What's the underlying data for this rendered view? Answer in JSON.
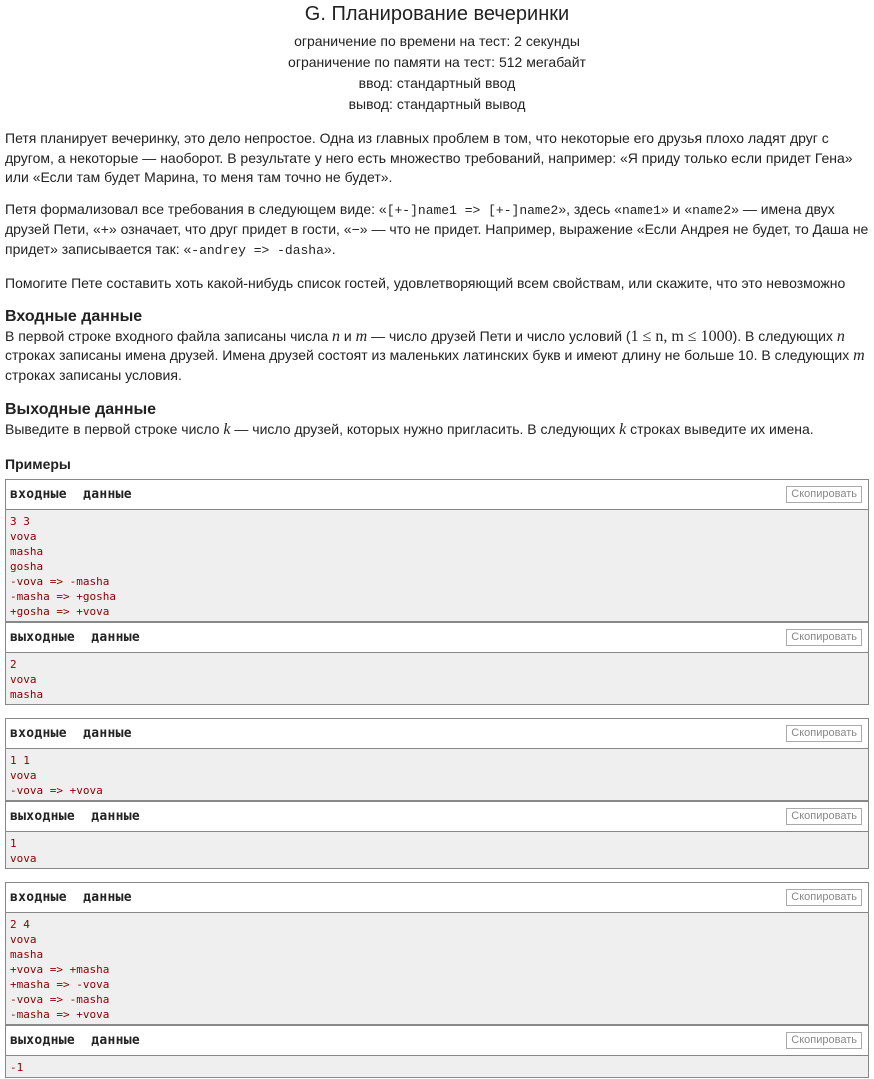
{
  "problem": {
    "title": "G. Планирование вечеринки",
    "time_limit": "ограничение по времени на тест: 2 секунды",
    "memory_limit": "ограничение по памяти на тест: 512 мегабайт",
    "input": "ввод: стандартный ввод",
    "output": "вывод: стандартный вывод"
  },
  "statement": {
    "p1": "Петя планирует вечеринку, это дело непростое. Одна из главных проблем в том, что некоторые его друзья плохо ладят друг с другом, а некоторые — наоборот. В результате у него есть множество требований, например: «Я приду только если придет Гена» или «Если там будет Марина, то меня там точно не будет».",
    "p2_a": "Петя формализовал все требования в следующем виде: «",
    "p2_code1": "[+-]name1 => [+-]name2",
    "p2_b": "», здесь «",
    "p2_code2": "name1",
    "p2_c": "» и «",
    "p2_code3": "name2",
    "p2_d": "» — имена двух друзей Пети, «+» означает, что друг придет в гости, «−» — что не придет. Например, выражение «Если Андрея не будет, то Даша не придет» записывается так: «",
    "p2_code4": "-andrey => -dasha",
    "p2_e": "».",
    "p3": "Помогите Пете составить хоть какой-нибудь список гостей, удовлетворяющий всем свойствам, или скажите, что это невозможно"
  },
  "input_section": {
    "title": "Входные данные",
    "t1": "В первой строке входного файла записаны числа ",
    "n": "n",
    "and": " и ",
    "m": "m",
    "t2": " — число друзей Пети и число условий (",
    "constraint": "1 ≤ n, m ≤ 1000",
    "t3": "). В следующих ",
    "t4": " строках записаны имена друзей. Имена друзей состоят из маленьких латинских букв и имеют длину не больше 10. В следующих ",
    "t5": " строках записаны условия."
  },
  "output_section": {
    "title": "Выходные данные",
    "t1": "Выведите в первой строке число ",
    "k": "k",
    "t2": " — число друзей, которых нужно пригласить. В следующих ",
    "t3": " строках выведите их имена."
  },
  "examples_title": "Примеры",
  "copy_label": "Скопировать",
  "input_label": "входные  данные",
  "output_label": "выходные  данные",
  "samples": [
    {
      "input": "3 3\nvova\nmasha\ngosha\n-vova => -masha\n-masha => +gosha\n+gosha => +vova",
      "output": "2\nvova\nmasha"
    },
    {
      "input": "1 1\nvova\n-vova => +vova",
      "output": "1\nvova"
    },
    {
      "input": "2 4\nvova\nmasha\n+vova => +masha\n+masha => -vova\n-vova => -masha\n-masha => +vova",
      "output": "-1"
    }
  ]
}
